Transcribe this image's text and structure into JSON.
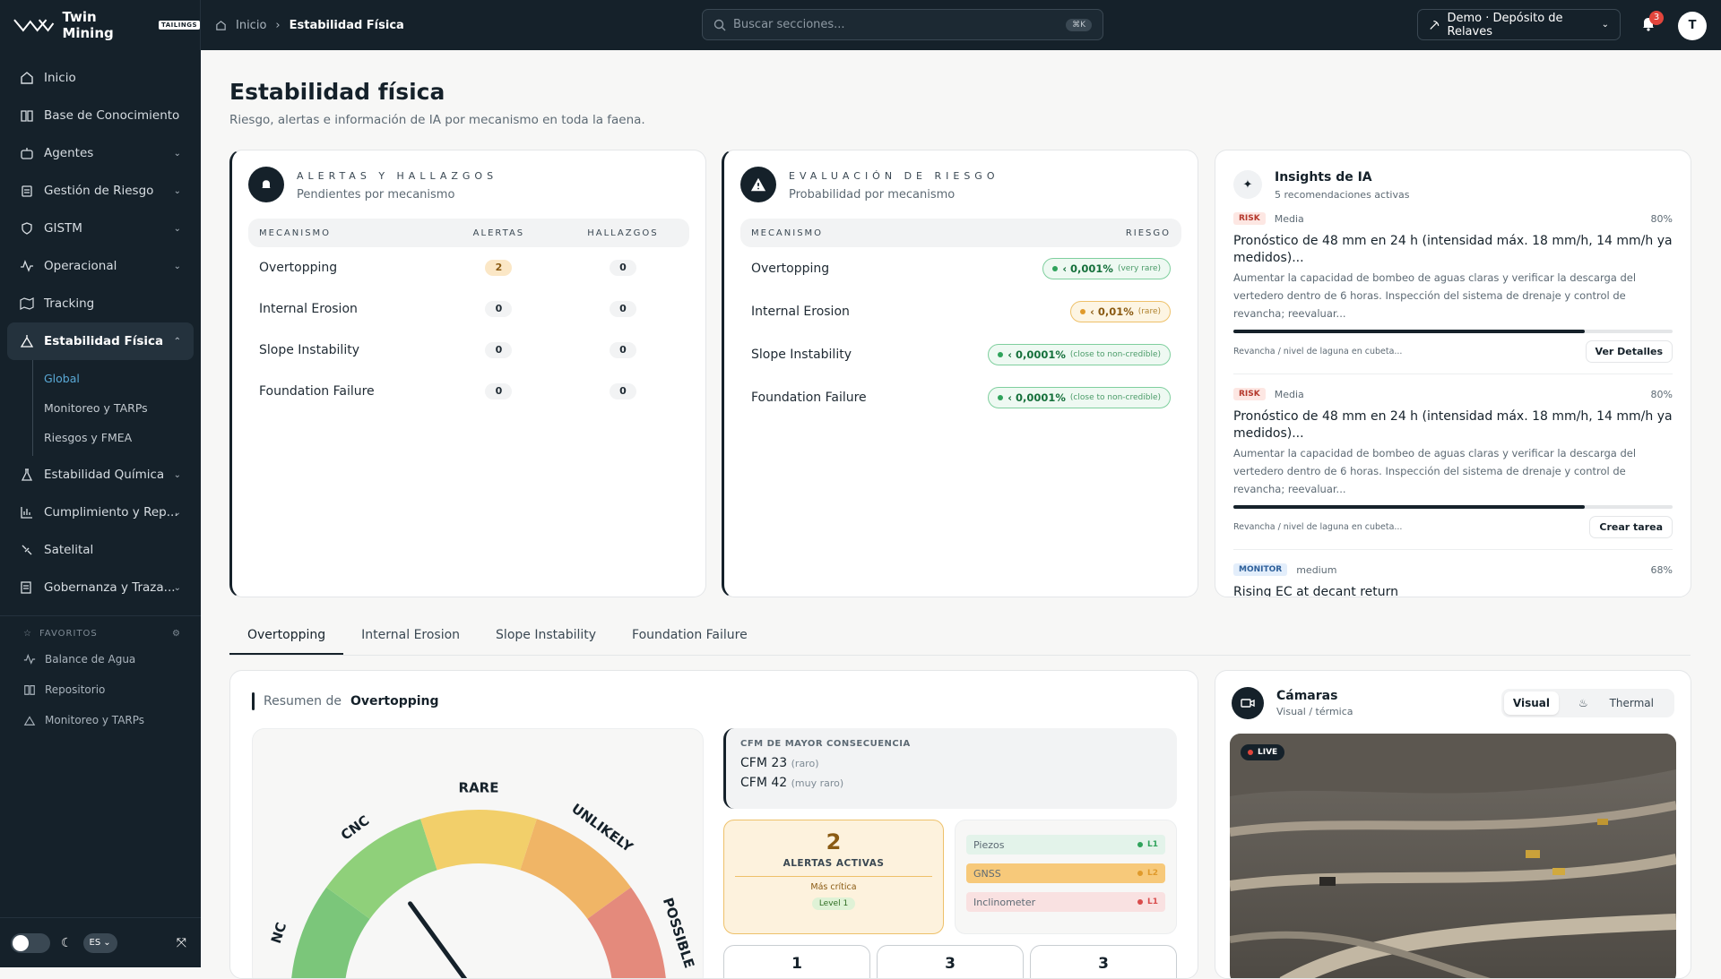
{
  "app": {
    "brand": "Twin Mining",
    "brand_tag": "TAILINGS",
    "breadcrumb": [
      "Inicio",
      "Estabilidad Física"
    ],
    "search_placeholder": "Buscar secciones...",
    "search_shortcut": "⌘K",
    "site_selector": "Demo · Depósito de Relaves",
    "notifications_count": "3",
    "avatar_initial": "T"
  },
  "sidebar": {
    "items": [
      {
        "label": "Inicio",
        "icon": "home-icon"
      },
      {
        "label": "Base de Conocimiento",
        "icon": "book-icon"
      },
      {
        "label": "Agentes",
        "icon": "bot-icon"
      },
      {
        "label": "Gestión de Riesgo",
        "icon": "clipboard-icon"
      },
      {
        "label": "GISTM",
        "icon": "shield-icon"
      },
      {
        "label": "Operacional",
        "icon": "activity-icon"
      },
      {
        "label": "Tracking",
        "icon": "map-icon"
      },
      {
        "label": "Estabilidad Física",
        "icon": "stability-icon"
      },
      {
        "label": "Estabilidad Química",
        "icon": "flask-icon"
      },
      {
        "label": "Cumplimiento y Rep...",
        "icon": "chart-icon"
      },
      {
        "label": "Satelital",
        "icon": "satellite-icon"
      },
      {
        "label": "Gobernanza y Traza...",
        "icon": "governance-icon"
      }
    ],
    "subitems": [
      "Global",
      "Monitoreo y TARPs",
      "Riesgos y FMEA"
    ],
    "favorites_label": "FAVORITOS",
    "favorites": [
      "Balance de Agua",
      "Repositorio",
      "Monitoreo y TARPs"
    ],
    "lang": "ES"
  },
  "page": {
    "title": "Estabilidad física",
    "subtitle": "Riesgo, alertas e información de IA por mecanismo en toda la faena."
  },
  "alerts_card": {
    "title": "ALERTAS Y HALLAZGOS",
    "subtitle": "Pendientes por mecanismo",
    "headers": [
      "MECANISMO",
      "ALERTAS",
      "HALLAZGOS"
    ],
    "rows": [
      {
        "mechanism": "Overtopping",
        "alerts": "2",
        "findings": "0"
      },
      {
        "mechanism": "Internal Erosion",
        "alerts": "0",
        "findings": "0"
      },
      {
        "mechanism": "Slope Instability",
        "alerts": "0",
        "findings": "0"
      },
      {
        "mechanism": "Foundation Failure",
        "alerts": "0",
        "findings": "0"
      }
    ]
  },
  "risk_card": {
    "title": "EVALUACIÓN DE RIESGO",
    "subtitle": "Probabilidad por mecanismo",
    "headers": [
      "MECANISMO",
      "RIESGO"
    ],
    "rows": [
      {
        "mechanism": "Overtopping",
        "value": "‹ 0,001%",
        "note": "(very rare)",
        "level": "green"
      },
      {
        "mechanism": "Internal Erosion",
        "value": "‹ 0,01%",
        "note": "(rare)",
        "level": "amber"
      },
      {
        "mechanism": "Slope Instability",
        "value": "‹ 0,0001%",
        "note": "(close to non-credible)",
        "level": "green"
      },
      {
        "mechanism": "Foundation Failure",
        "value": "‹ 0,0001%",
        "note": "(close to non-credible)",
        "level": "green"
      }
    ]
  },
  "insights_card": {
    "title": "Insights de IA",
    "subtitle": "5 recomendaciones activas",
    "items": [
      {
        "tag": "RISK",
        "severity": "Media",
        "confidence": "80%",
        "progress": 0.8,
        "title": "Pronóstico de 48 mm en 24 h (intensidad máx. 18 mm/h, 14 mm/h ya medidos)...",
        "desc": "Aumentar la capacidad de bombeo de aguas claras y verificar la descarga del vertedero dentro de 6 horas. Inspección del sistema de drenaje y control de revancha; reevaluar...",
        "source": "Revancha / nivel de laguna en cubeta...",
        "action": "Ver Detalles"
      },
      {
        "tag": "RISK",
        "severity": "Media",
        "confidence": "80%",
        "progress": 0.8,
        "title": "Pronóstico de 48 mm en 24 h (intensidad máx. 18 mm/h, 14 mm/h ya medidos)...",
        "desc": "Aumentar la capacidad de bombeo de aguas claras y verificar la descarga del vertedero dentro de 6 horas. Inspección del sistema de drenaje y control de revancha; reevaluar...",
        "source": "Revancha / nivel de laguna en cubeta...",
        "action": "Crear tarea"
      },
      {
        "tag": "MONITOR",
        "severity": "medium",
        "confidence": "68%",
        "title": "Rising EC at decant return"
      }
    ]
  },
  "tabs": [
    "Overtopping",
    "Internal Erosion",
    "Slope Instability",
    "Foundation Failure"
  ],
  "summary": {
    "prefix": "Resumen de",
    "mechanism": "Overtopping",
    "gauge_labels": [
      "NC",
      "CNC",
      "RARE",
      "UNLIKELY",
      "POSSIBLE"
    ],
    "gauge_colors": [
      "#7bc67a",
      "#8fd07a",
      "#f2cf6a",
      "#f0b566",
      "#e48a7c"
    ],
    "gauge_needle_value": "CNC",
    "cfm_title": "CFM DE MAYOR CONSECUENCIA",
    "cfm_lines": [
      {
        "label": "CFM 23",
        "note": "(raro)"
      },
      {
        "label": "CFM 42",
        "note": "(muy raro)"
      }
    ],
    "active_alerts_count": "2",
    "active_alerts_label": "ALERTAS ACTIVAS",
    "most_critical_label": "Más crítica",
    "level_badge": "Level 1",
    "sensors": [
      {
        "name": "Piezos",
        "level": "L1",
        "color": "#2fa35b",
        "bg": "#e3f3ea"
      },
      {
        "name": "GNSS",
        "level": "L2",
        "color": "#e09a2b",
        "bg": "#f7c97a"
      },
      {
        "name": "Inclinometer",
        "level": "L1",
        "color": "#d94b4b",
        "bg": "#f9e1e1"
      }
    ],
    "mini_counts": [
      "1",
      "3",
      "3"
    ]
  },
  "cameras": {
    "title": "Cámaras",
    "subtitle": "Visual / térmica",
    "modes": [
      "Visual",
      "Thermal"
    ],
    "live_label": "LIVE"
  }
}
